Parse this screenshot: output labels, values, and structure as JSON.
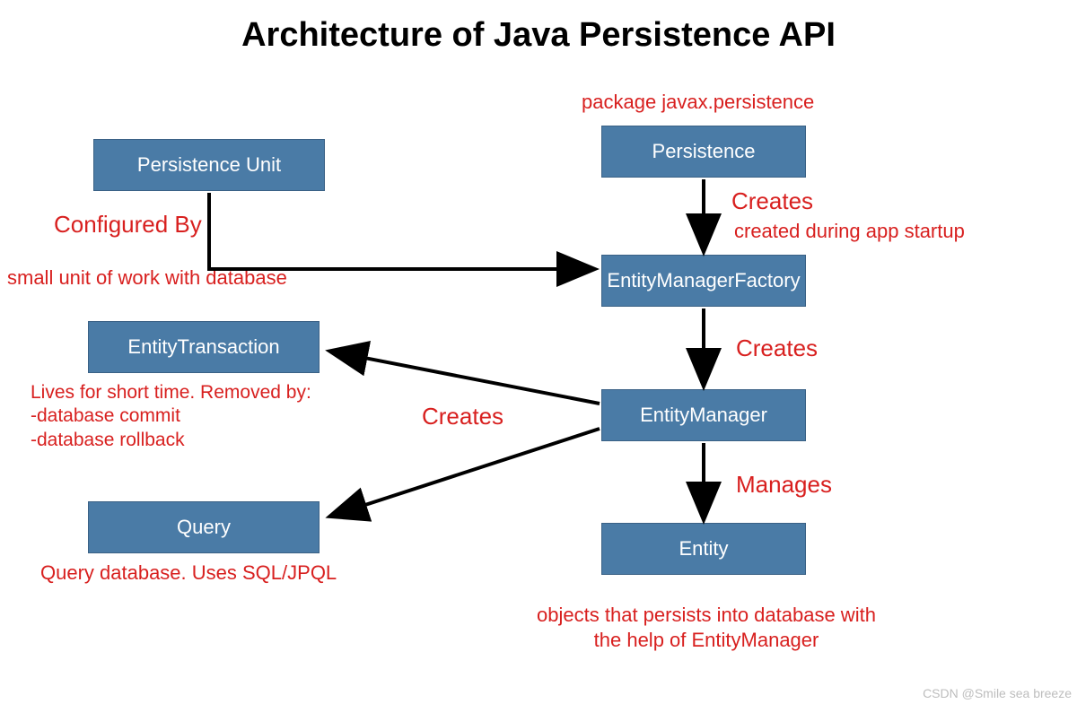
{
  "title": "Architecture of Java Persistence API",
  "boxes": {
    "persistence_unit": "Persistence Unit",
    "entity_transaction": "EntityTransaction",
    "query": "Query",
    "persistence": "Persistence",
    "entity_manager_factory": "EntityManagerFactory",
    "entity_manager": "EntityManager",
    "entity": "Entity"
  },
  "labels": {
    "package": "package javax.persistence",
    "configured_by": "Configured By",
    "small_unit": "small unit of work with database",
    "transaction_note": "Lives for short time. Removed by:\n-database commit\n-database rollback",
    "query_note": "Query database. Uses SQL/JPQL",
    "creates1": "Creates",
    "created_during": "created during app startup",
    "creates2": "Creates",
    "creates_mid": "Creates",
    "manages": "Manages",
    "entity_note": "objects that persists into database with\nthe help of EntityManager"
  },
  "watermark": "CSDN @Smile sea breeze"
}
